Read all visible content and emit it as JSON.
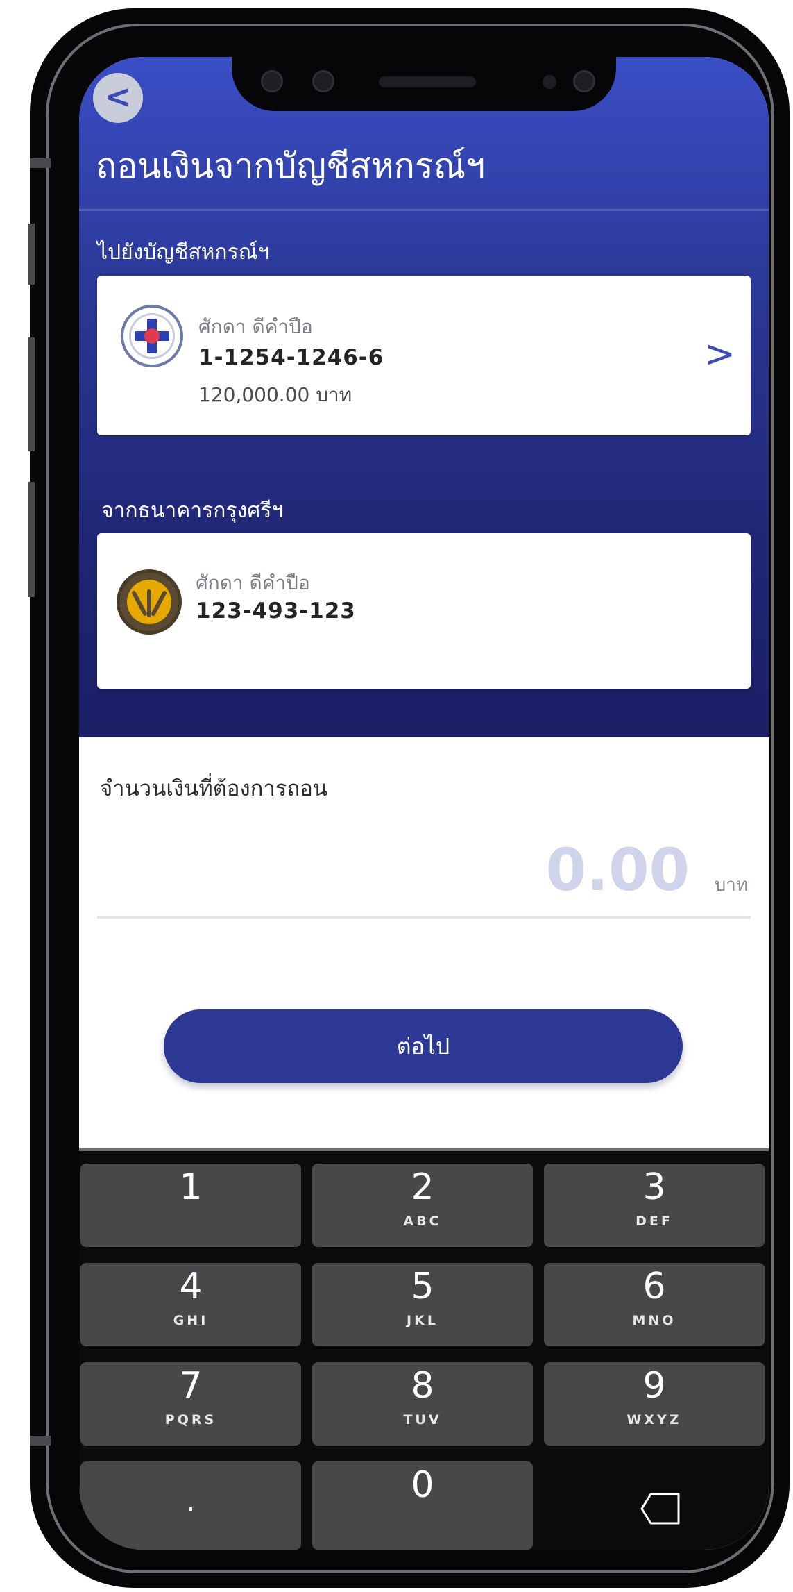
{
  "header": {
    "title": "ถอนเงินจากบัญชีสหกรณ์ฯ",
    "back_icon": "<"
  },
  "to_section": {
    "label": "ไปยังบัญชีสหกรณ์ฯ",
    "name": "ศักดา ดีคำปือ",
    "account": "1-1254-1246-6",
    "balance": "120,000.00 บาท",
    "chevron": ">",
    "logo_icon": "coop-logo-icon"
  },
  "from_section": {
    "label": "จากธนาคารกรุงศรีฯ",
    "name": "ศักดา ดีคำปือ",
    "account": "123-493-123",
    "logo_icon": "krungsri-logo-icon"
  },
  "amount": {
    "label": "จำนวนเงินที่ต้องการถอน",
    "value": "0.00",
    "unit": "บาท"
  },
  "next_button": {
    "label": "ต่อไป"
  },
  "keypad": {
    "keys": [
      {
        "num": "1",
        "letters": ""
      },
      {
        "num": "2",
        "letters": "ABC"
      },
      {
        "num": "3",
        "letters": "DEF"
      },
      {
        "num": "4",
        "letters": "GHI"
      },
      {
        "num": "5",
        "letters": "JKL"
      },
      {
        "num": "6",
        "letters": "MNO"
      },
      {
        "num": "7",
        "letters": "PQRS"
      },
      {
        "num": "8",
        "letters": "TUV"
      },
      {
        "num": "9",
        "letters": "WXYZ"
      },
      {
        "num": ".",
        "letters": ""
      },
      {
        "num": "0",
        "letters": ""
      }
    ]
  },
  "colors": {
    "header_top": "#3a4ec6",
    "header_bottom": "#1b1f66",
    "accent": "#2d3894",
    "amount_placeholder": "#cfd4ea",
    "key": "#48484a"
  }
}
